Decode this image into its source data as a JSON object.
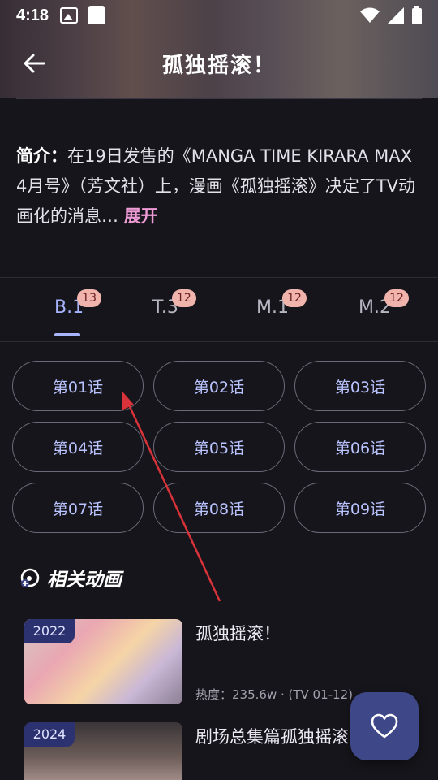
{
  "status_bar": {
    "time": "4:18"
  },
  "header": {
    "title": "孤独摇滚！"
  },
  "intro": {
    "label": "简介：",
    "text": "在19日发售的《MANGA TIME KIRARA MAX 4月号》（芳文社）上，漫画《孤独摇滚》决定了TV动画化的消息…",
    "expand_label": "展开"
  },
  "tabs": [
    {
      "label": "B.1",
      "badge": "13",
      "active": true
    },
    {
      "label": "T.3",
      "badge": "12",
      "active": false
    },
    {
      "label": "M.1",
      "badge": "12",
      "active": false
    },
    {
      "label": "M.2",
      "badge": "12",
      "active": false
    }
  ],
  "episodes": [
    "第01话",
    "第02话",
    "第03话",
    "第04话",
    "第05话",
    "第06话",
    "第07话",
    "第08话",
    "第09话"
  ],
  "related": {
    "title": "相关动画",
    "items": [
      {
        "year": "2022",
        "title": "孤独摇滚！",
        "meta": "热度：235.6w · (TV 01-12)"
      },
      {
        "year": "2024",
        "title": "剧场总集篇孤独摇滚",
        "meta": ""
      }
    ]
  },
  "colors": {
    "accent": "#a9b4ff",
    "badge": "#f1b4ad",
    "expand": "#ef9bd6",
    "fab": "#3e4787"
  },
  "icons": {
    "back": "arrow-left-icon",
    "favorite": "heart-icon",
    "related": "tv-plus-icon"
  }
}
